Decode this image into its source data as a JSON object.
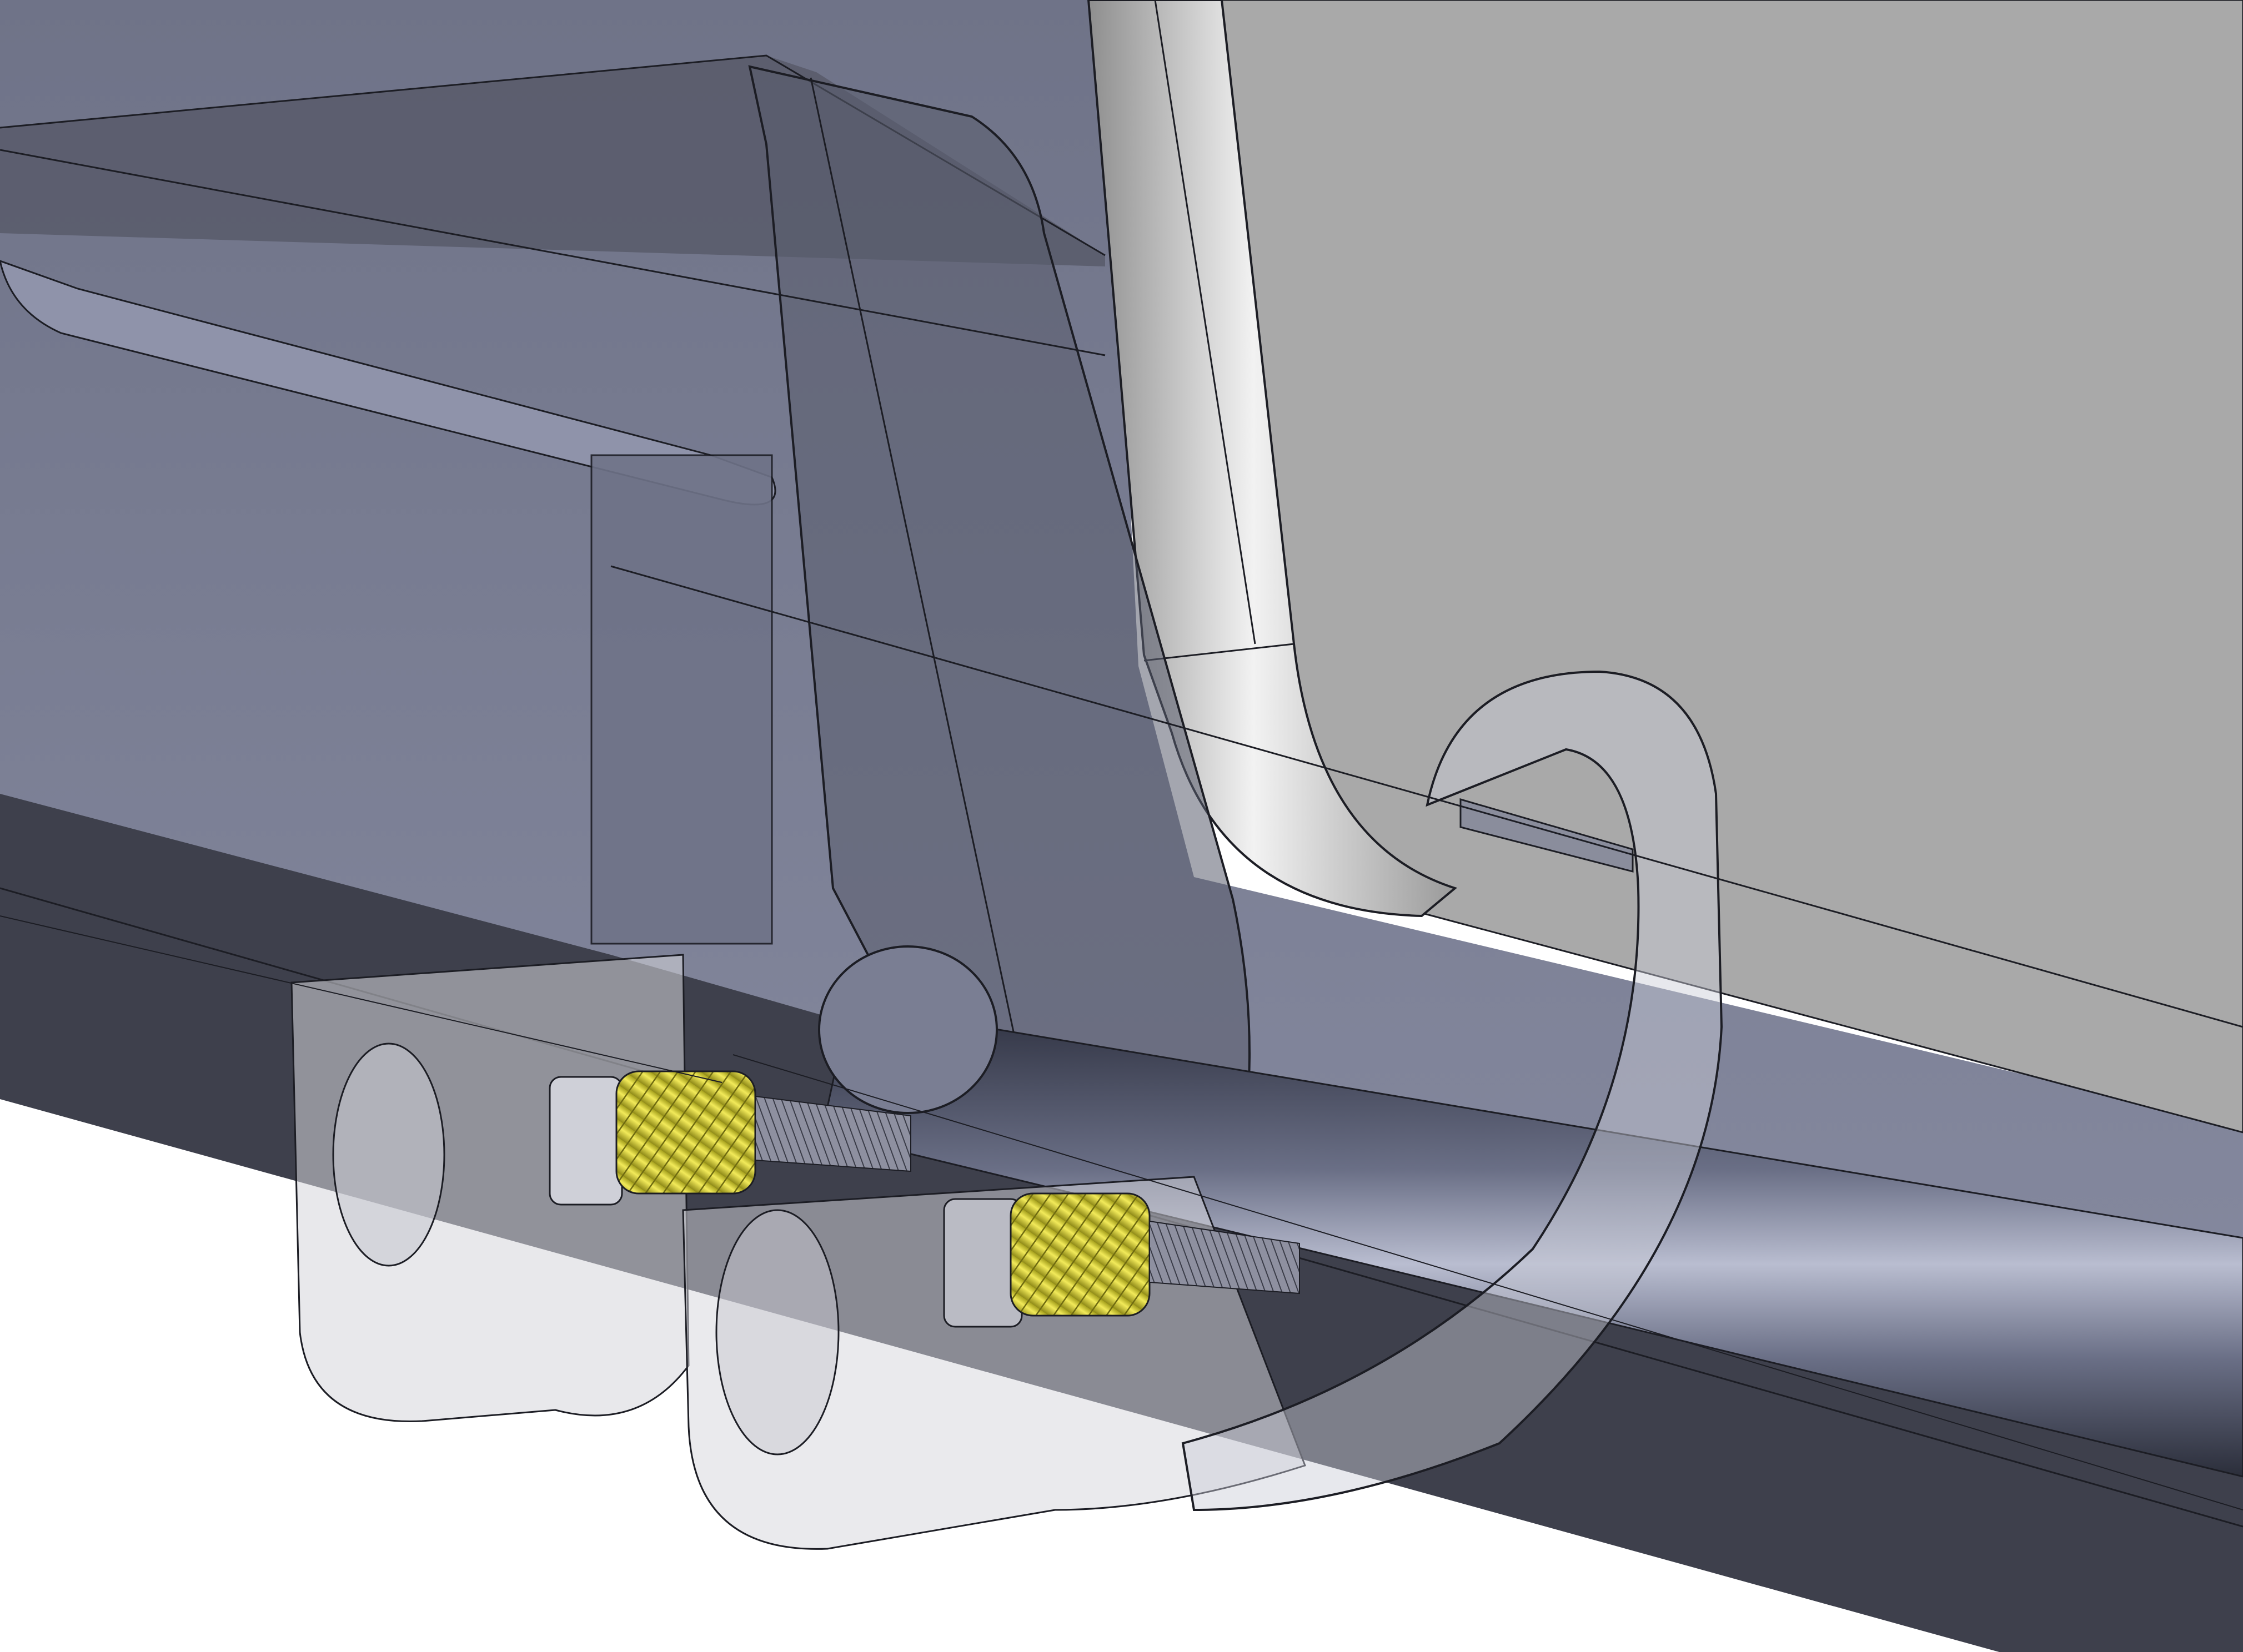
{
  "viewport": {
    "scene": "cad-assembly-xray",
    "palette": {
      "background": "#ffffff",
      "panel": "#a9a9a9",
      "panel_edge": "#5a5a5a",
      "frame_dark": "#3e404c",
      "frame_mid": "#7e8297",
      "frame_light": "#b5b9c8",
      "ghost_fill": "#d6d6db",
      "insert_brass": "#d9d23a",
      "insert_dark": "#8f8a18",
      "edge_line": "#1c1d24"
    }
  }
}
